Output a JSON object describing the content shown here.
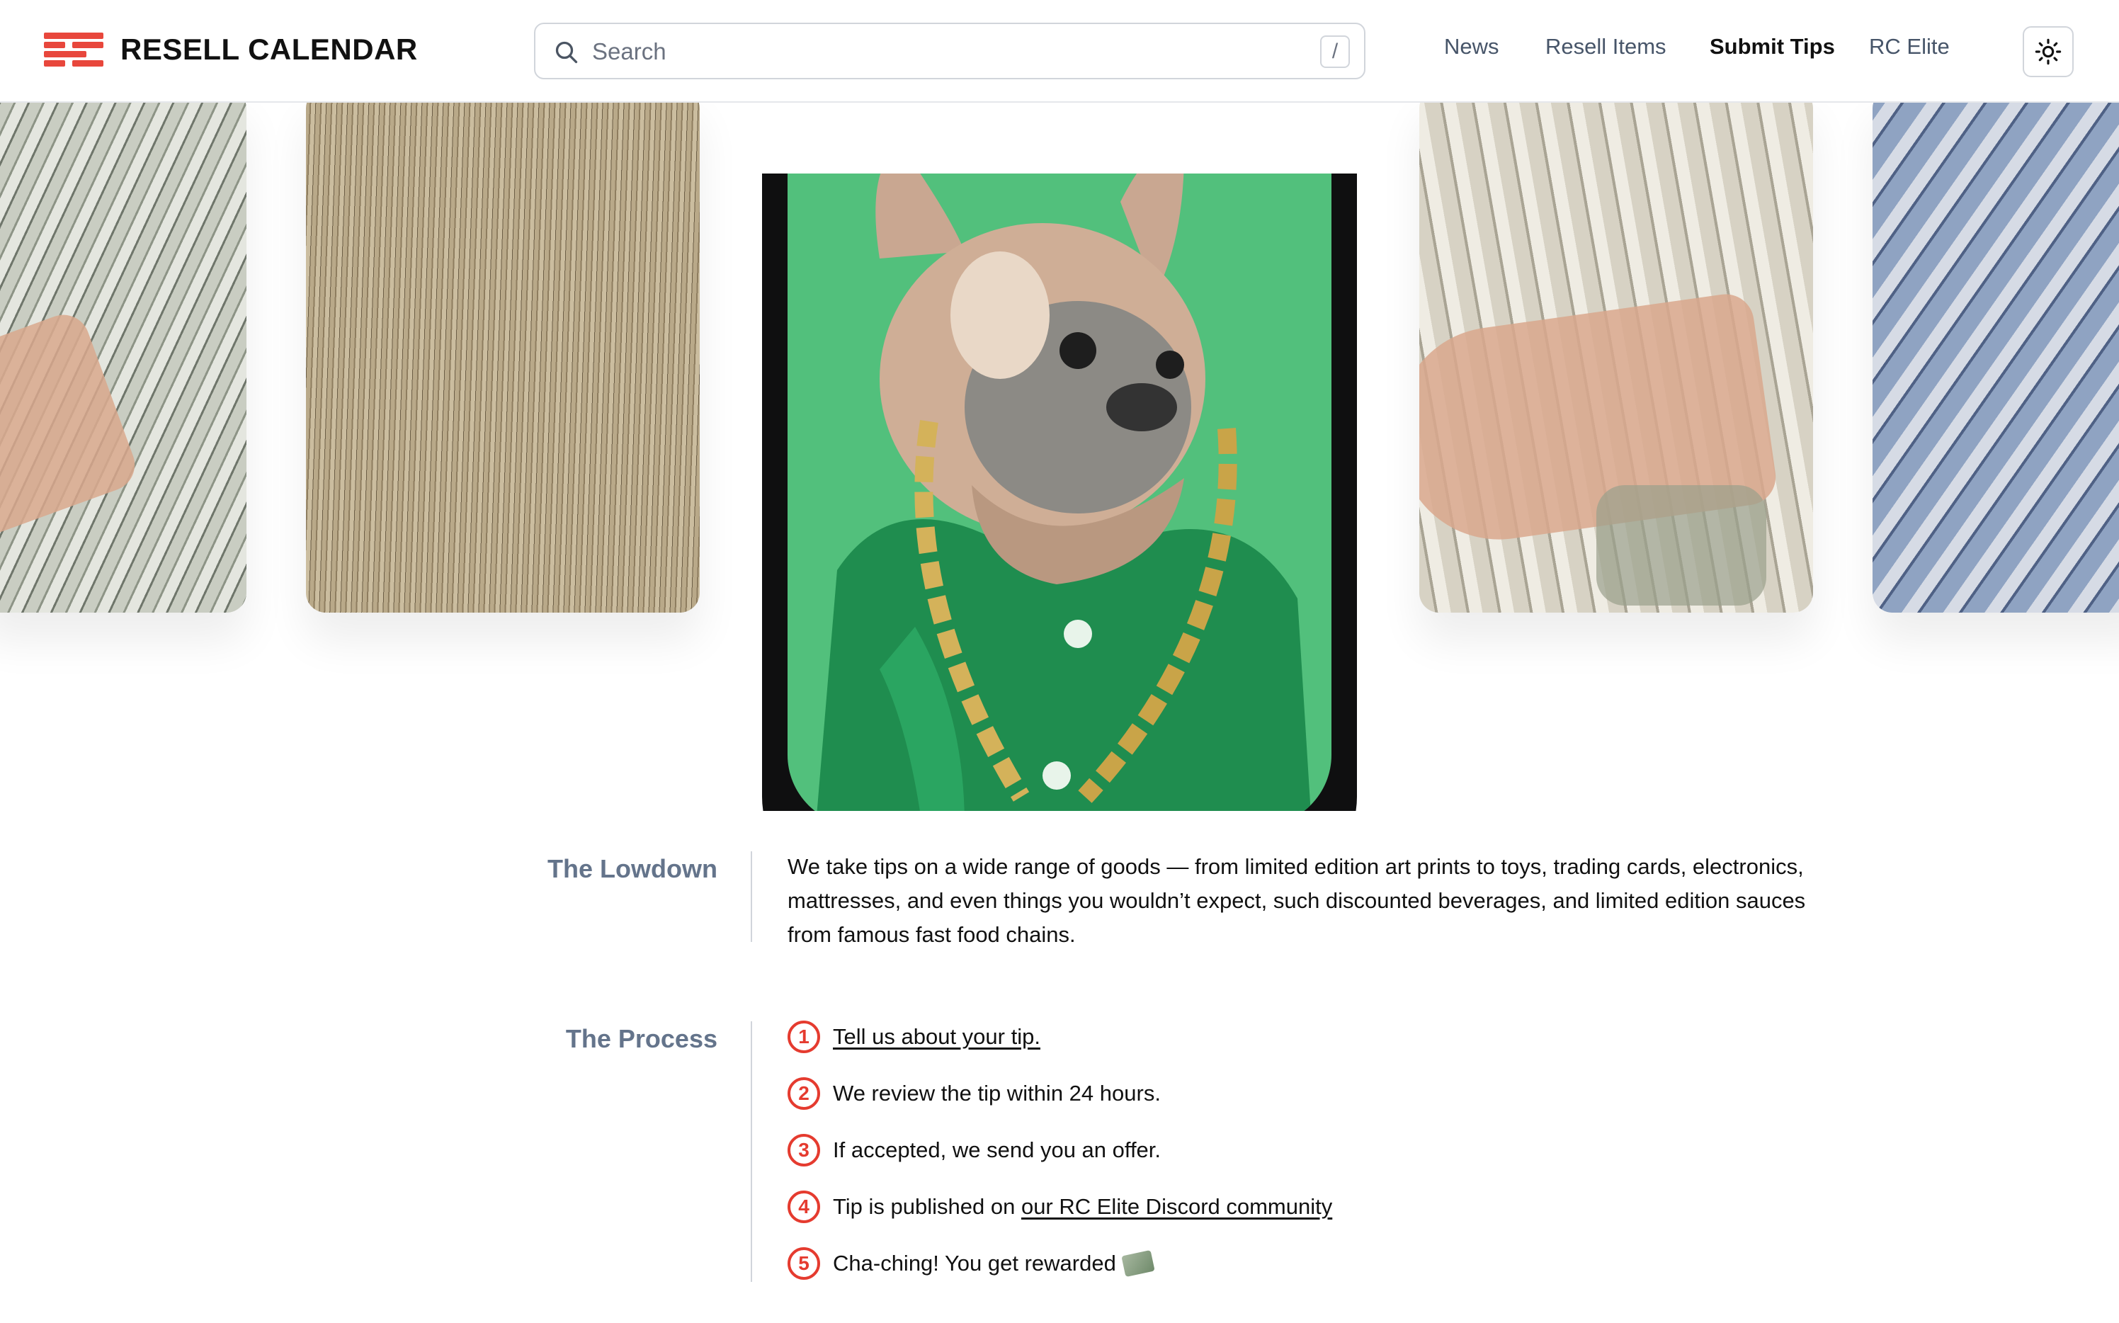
{
  "brand": {
    "name": "RESELL CALENDAR",
    "accent": "#e8473c"
  },
  "search": {
    "placeholder": "Search",
    "shortcut": "/"
  },
  "nav": {
    "items": [
      {
        "label": "News",
        "active": false
      },
      {
        "label": "Resell Items",
        "active": false
      },
      {
        "label": "Submit Tips",
        "active": true
      },
      {
        "label": "RC Elite",
        "active": false
      }
    ],
    "theme_icon": "sun-icon"
  },
  "hero": {
    "cards": [
      "cash-fan-image",
      "cash-stack-image",
      "french-bulldog-phone-image",
      "hundred-dollar-hand-image",
      "twenty-dollar-bills-image"
    ]
  },
  "lowdown": {
    "heading": "The Lowdown",
    "text": "We take tips on a wide range of goods — from limited edition art prints to toys, trading cards, electronics, mattresses, and even things you wouldn’t expect, such discounted beverages, and limited edition sauces from famous fast food chains."
  },
  "process": {
    "heading": "The Process",
    "steps": [
      {
        "num": "1",
        "text": "Tell us about your tip.",
        "link": true
      },
      {
        "num": "2",
        "text": "We review the tip within 24 hours."
      },
      {
        "num": "3",
        "text": "If accepted, we send you an offer."
      },
      {
        "num": "4",
        "prefix": "Tip is published on ",
        "link_text": "our RC Elite Discord community"
      },
      {
        "num": "5",
        "text": "Cha-ching! You get rewarded",
        "emoji": "money-with-wings-icon"
      }
    ],
    "accent": "#e53b2f"
  }
}
